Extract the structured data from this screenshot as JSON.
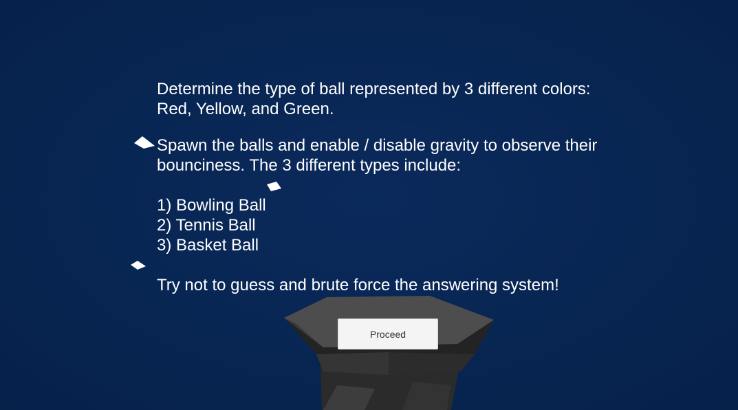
{
  "instructions": {
    "line1": "Determine the type of ball represented by 3 different colors:",
    "line2": "Red, Yellow, and Green.",
    "line3": "Spawn the balls and enable / disable gravity to observe their",
    "line4": "bounciness. The 3 different types include:",
    "item1": "1) Bowling Ball",
    "item2": "2) Tennis Ball",
    "item3": "3) Basket Ball",
    "warning": "Try not to guess and brute force the answering system!"
  },
  "proceed_button": {
    "label": "Proceed"
  },
  "colors": {
    "background": "#07244f",
    "text": "#ffffff",
    "pedestal_top": "#4a4a4a",
    "pedestal_side": "#2f2f2f",
    "button_bg": "#f4f4f4"
  }
}
